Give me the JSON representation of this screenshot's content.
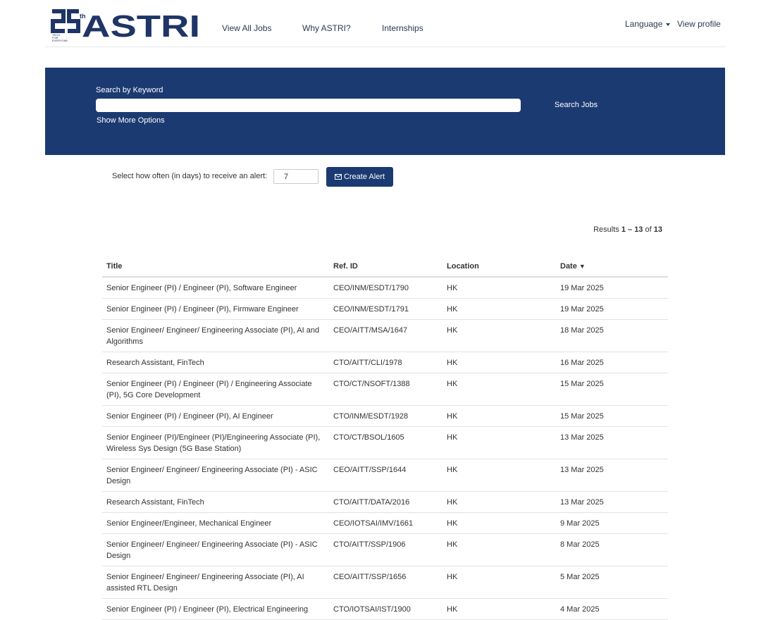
{
  "header": {
    "logo_text": "25th ASTRI",
    "logo_tagline": "TECH FOR EVERYONE",
    "nav": [
      {
        "label": "View All Jobs"
      },
      {
        "label": "Why ASTRI?"
      },
      {
        "label": "Internships"
      }
    ],
    "language_label": "Language",
    "profile_label": "View profile"
  },
  "search": {
    "keyword_label": "Search by Keyword",
    "keyword_value": "",
    "more_options_label": "Show More Options",
    "button_label": "Search Jobs"
  },
  "alert": {
    "label": "Select how often (in days) to receive an alert:",
    "frequency_value": "7",
    "button_label": "Create Alert",
    "button_icon": "envelope-icon"
  },
  "results": {
    "prefix": "Results",
    "range": "1 – 13",
    "of_label": "of",
    "total": "13"
  },
  "table": {
    "headers": {
      "title": "Title",
      "ref": "Ref. ID",
      "location": "Location",
      "date": "Date"
    },
    "sort_indicator": "▼",
    "rows": [
      {
        "title": "Senior Engineer (PI) / Engineer (PI), Software Engineer",
        "ref": "CEO/INM/ESDT/1790",
        "location": "HK",
        "date": "19 Mar 2025"
      },
      {
        "title": "Senior Engineer (PI) / Engineer (PI), Firmware Engineer",
        "ref": "CEO/INM/ESDT/1791",
        "location": "HK",
        "date": "19 Mar 2025"
      },
      {
        "title": "Senior Engineer/ Engineer/ Engineering Associate (PI), AI and Algorithms",
        "ref": "CEO/AITT/MSA/1647",
        "location": "HK",
        "date": "18 Mar 2025"
      },
      {
        "title": "Research Assistant, FinTech",
        "ref": "CTO/AITT/CLI/1978",
        "location": "HK",
        "date": "16 Mar 2025"
      },
      {
        "title": "Senior Engineer (PI) / Engineer (PI) / Engineering Associate (PI), 5G Core Development",
        "ref": "CTO/CT/NSOFT/1388",
        "location": "HK",
        "date": "15 Mar 2025"
      },
      {
        "title": "Senior Engineer (PI) / Engineer (PI), AI Engineer",
        "ref": "CTO/INM/ESDT/1928",
        "location": "HK",
        "date": "15 Mar 2025"
      },
      {
        "title": "Senior Engineer (PI)/Engineer (PI)/Engineering Associate (PI), Wireless Sys Design (5G Base Station)",
        "ref": "CTO/CT/BSOL/1605",
        "location": "HK",
        "date": "13 Mar 2025"
      },
      {
        "title": "Senior Engineer/ Engineer/ Engineering Associate (PI) - ASIC Design",
        "ref": "CEO/AITT/SSP/1644",
        "location": "HK",
        "date": "13 Mar 2025"
      },
      {
        "title": "Research Assistant, FinTech",
        "ref": "CTO/AITT/DATA/2016",
        "location": "HK",
        "date": "13 Mar 2025"
      },
      {
        "title": "Senior Engineer/Engineer, Mechanical Engineer",
        "ref": "CEO/IOTSAI/IMV/1661",
        "location": "HK",
        "date": "9 Mar 2025"
      },
      {
        "title": "Senior Engineer/ Engineer/ Engineering Associate (PI) - ASIC Design",
        "ref": "CTO/AITT/SSP/1906",
        "location": "HK",
        "date": "8 Mar 2025"
      },
      {
        "title": "Senior Engineer/ Engineer/ Engineering Associate (PI), AI assisted RTL Design",
        "ref": "CEO/AITT/SSP/1656",
        "location": "HK",
        "date": "5 Mar 2025"
      },
      {
        "title": "Senior Engineer (PI) / Engineer (PI), Electrical Engineering",
        "ref": "CTO/IOTSAI/IST/1900",
        "location": "HK",
        "date": "4 Mar 2025"
      }
    ]
  },
  "colors": {
    "brand": "#1c3a72",
    "logo": "#1e3566"
  }
}
